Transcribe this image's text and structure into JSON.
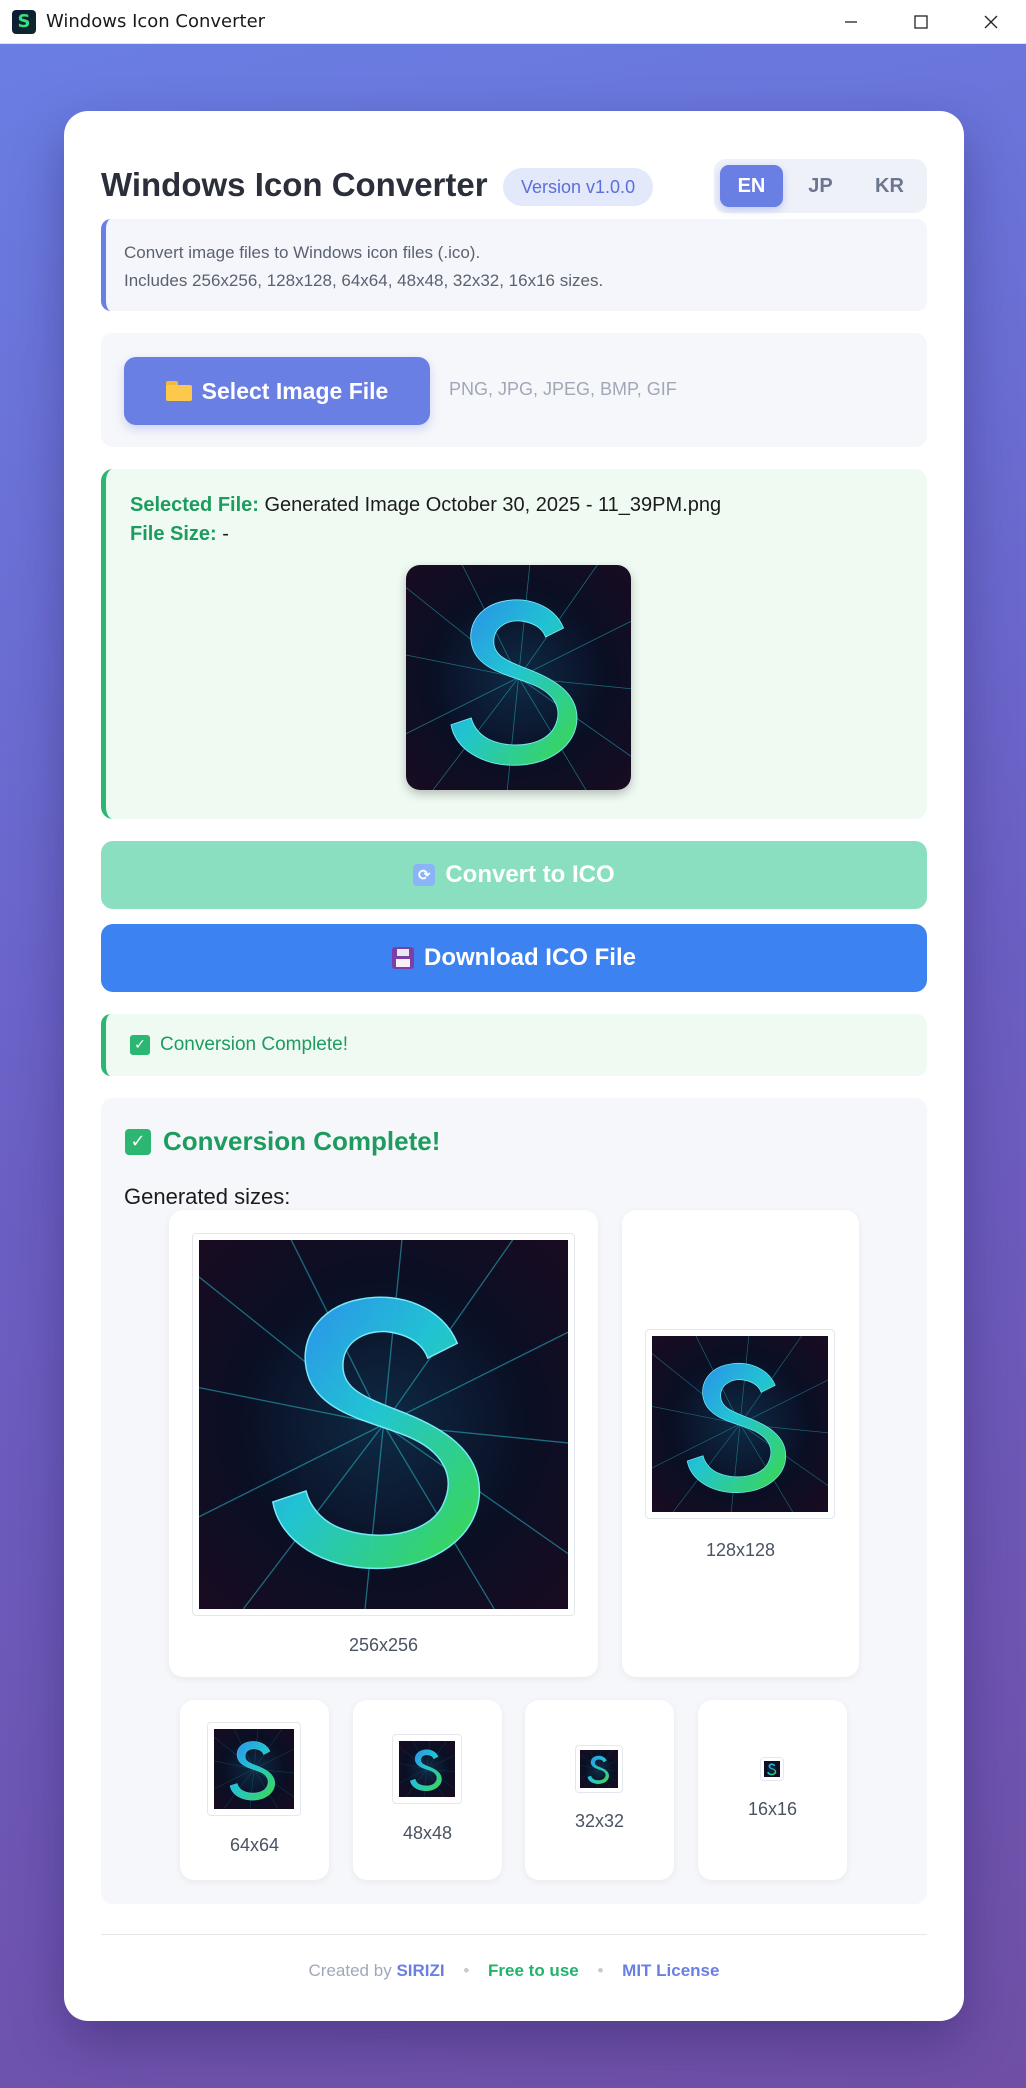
{
  "window": {
    "title": "Windows Icon Converter"
  },
  "header": {
    "title": "Windows Icon Converter",
    "version": "Version v1.0.0",
    "languages": [
      "EN",
      "JP",
      "KR"
    ],
    "active_language": "EN"
  },
  "info": {
    "line1": "Convert image files to Windows icon files (.ico).",
    "line2": "Includes 256x256, 128x128, 64x64, 48x48, 32x32, 16x16 sizes."
  },
  "select": {
    "button_label": "Select Image File",
    "formats": "PNG, JPG, JPEG, BMP, GIF"
  },
  "file": {
    "name_label": "Selected File:",
    "name_value": "Generated Image October 30, 2025 - 11_39PM.png",
    "size_label": "File Size:",
    "size_value": "-"
  },
  "actions": {
    "convert_label": "Convert to ICO",
    "download_label": "Download ICO File"
  },
  "status": {
    "message": "Conversion Complete!"
  },
  "results": {
    "title": "Conversion Complete!",
    "generated_label": "Generated sizes:",
    "sizes": [
      "256x256",
      "128x128",
      "64x64",
      "48x48",
      "32x32",
      "16x16"
    ]
  },
  "footer": {
    "created_by": "Created by",
    "author": "SIRIZI",
    "free": "Free to use",
    "license": "MIT License"
  },
  "colors": {
    "accent": "#6a7fe4",
    "success": "#2bb672",
    "download": "#3c82f0"
  }
}
